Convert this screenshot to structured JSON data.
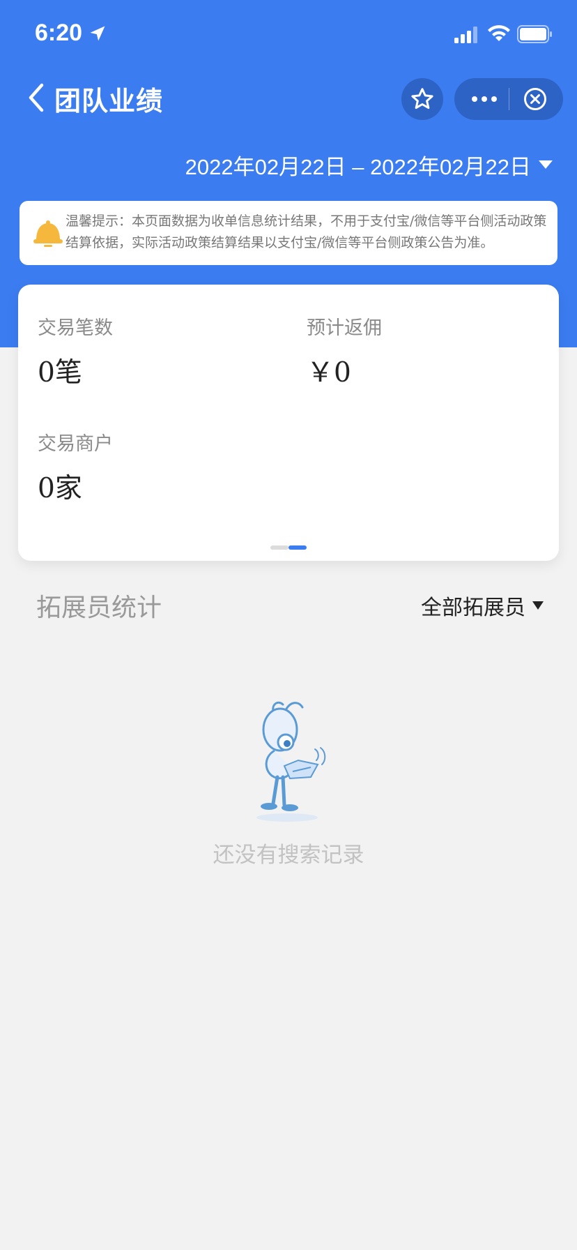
{
  "status_bar": {
    "time": "6:20",
    "icons": [
      "location-arrow-icon",
      "signal-icon",
      "wifi-icon",
      "battery-icon"
    ]
  },
  "nav": {
    "title": "团队业绩",
    "icons": [
      "back-icon",
      "star-icon",
      "more-icon",
      "close-circle-icon"
    ]
  },
  "date_range": {
    "text": "2022年02月22日 – 2022年02月22日"
  },
  "notice": {
    "text": "温馨提示：本页面数据为收单信息统计结果，不用于支付宝/微信等平台侧活动政策结算依据，实际活动政策结算结果以支付宝/微信等平台侧政策公告为准。"
  },
  "stats": {
    "trades": {
      "label": "交易笔数",
      "value": "0笔"
    },
    "rebate": {
      "label": "预计返佣",
      "value": "￥0"
    },
    "merchants": {
      "label": "交易商户",
      "value": "0家"
    },
    "pager": {
      "pages": 2,
      "current": 2
    }
  },
  "section": {
    "title": "拓展员统计",
    "filter_label": "全部拓展员"
  },
  "empty_state": {
    "text": "还没有搜索记录"
  },
  "colors": {
    "primary": "#3b7cf0",
    "nav_button": "#2e63c6",
    "background": "#f2f2f2",
    "bell": "#f5b83d"
  }
}
